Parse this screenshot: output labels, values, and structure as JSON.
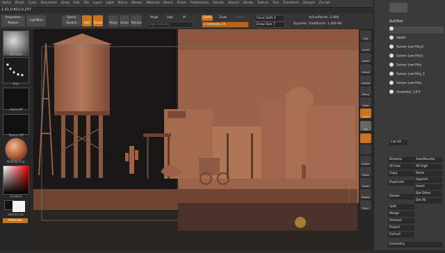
{
  "menu": [
    "Alpha",
    "Brush",
    "Color",
    "Document",
    "Draw",
    "Edit",
    "File",
    "Layer",
    "Light",
    "Macro",
    "Marker",
    "Material",
    "Movie",
    "Picker",
    "Preferences",
    "Render",
    "Stencil",
    "Stroke",
    "Texture",
    "Tool",
    "Transform",
    "Zplugin",
    "Zscript"
  ],
  "coords": "1.01,0.822,0.257",
  "toolbar": {
    "projection_master": "Projection Master",
    "lightbox": "LightBox",
    "quick_sketch": "Quick Sketch",
    "edit": "Edit",
    "draw": "Draw",
    "move": "Move",
    "scale": "Scale",
    "rotate": "Rotate",
    "mrgb": "Mrgb",
    "rgb": "Rgb",
    "m": "M",
    "rgb_intensity": "Rgb Intensity",
    "zadd": "Zadd",
    "zsub": "Zsub",
    "zcut": "Zcut",
    "z_intensity": "Z Intensity 25",
    "focal_shift": "Focal Shift 0",
    "draw_size": "Draw Size 7",
    "dynamic": "Dynamic",
    "active_points": "ActivePoints: 2,468",
    "total_points": "TotalPoints: 1.468 Mil"
  },
  "left_shelf": {
    "brush_label": "Standard",
    "stroke_label": "Dots",
    "alpha_label": "Alpha Off",
    "texture_label": "Texture Off",
    "material_label": "MatCap Gray",
    "gradient_label": "Gradient",
    "switch_color_label": "SwitchColor",
    "alternate_label": "Alternate"
  },
  "right_shelf": [
    "SPix",
    "Scroll",
    "Zoom",
    "Actual",
    "AAHalf",
    "Persp",
    "Floor",
    "Local",
    "Xyz",
    "",
    "",
    "Frame",
    "Move",
    "Scale",
    "Rotate",
    "PolyF"
  ],
  "subtool": {
    "header": "SubTool",
    "items": [
      "",
      "wbbtil",
      "Saloon Low Poly2",
      "Saloon Low Poly1",
      "Saloon Low Poly",
      "Saloon Low Poly_1",
      "Saloon Low Poly",
      "doubotter_1#3"
    ],
    "list_all": "List All",
    "rename": "Rename",
    "auto_reorder": "AutoReorder",
    "all_low": "All Low",
    "all_high": "All High",
    "copy": "Copy",
    "paste": "Paste",
    "duplicate": "Duplicate",
    "append": "Append",
    "insert": "Insert",
    "delete": "Delete",
    "del_other": "Del Other",
    "del_all": "Del All",
    "split": "Split",
    "merge": "Merge",
    "remesh": "Remesh",
    "project": "Project",
    "extract": "Extract",
    "geometry": "Geometry"
  },
  "colors": {
    "accent": "#c9741f",
    "panel": "#3a3a3a",
    "clay": "#a46b4f"
  }
}
